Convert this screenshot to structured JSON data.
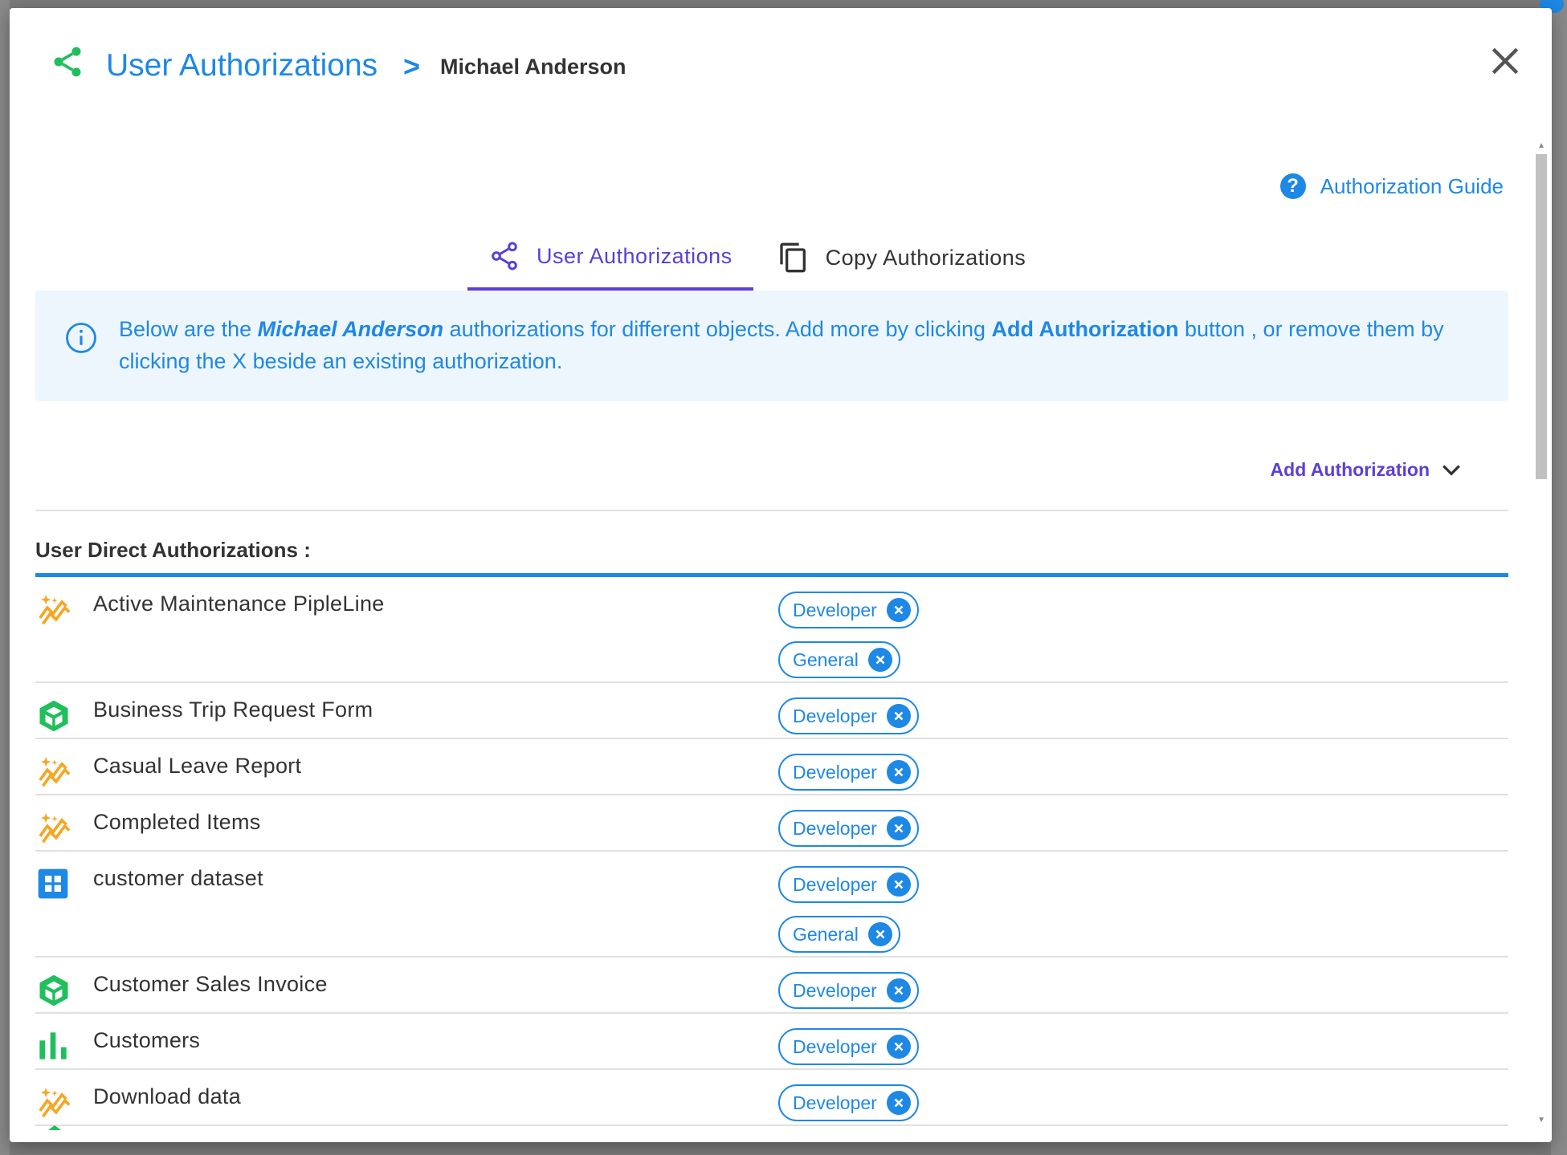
{
  "header": {
    "title": "User Authorizations",
    "separator": ">",
    "user_name": "Michael Anderson"
  },
  "guide": {
    "label": "Authorization Guide",
    "icon": "help-circle-icon"
  },
  "tabs": [
    {
      "label": "User Authorizations",
      "icon": "share-icon",
      "active": true
    },
    {
      "label": "Copy Authorizations",
      "icon": "copy-icon",
      "active": false
    }
  ],
  "info": {
    "part1": "Below are the ",
    "user_name": "Michael Anderson",
    "part2": " authorizations for different objects. Add more by clicking ",
    "button_ref": "Add Authorization",
    "part3": " button , or remove them by clicking the X beside an existing authorization."
  },
  "add_authorization": {
    "label": "Add Authorization"
  },
  "section": {
    "title": "User Direct Authorizations :"
  },
  "colors": {
    "primary": "#1e88e5",
    "accent": "#5c3fd6",
    "green": "#1fbf5b",
    "orange": "#f5a623"
  },
  "authorizations": [
    {
      "name": "Active Maintenance PipleLine",
      "icon": "pipeline-sparkle-icon",
      "roles": [
        "Developer",
        "General"
      ]
    },
    {
      "name": "Business Trip Request Form",
      "icon": "form-cube-icon",
      "roles": [
        "Developer"
      ]
    },
    {
      "name": "Casual Leave Report",
      "icon": "pipeline-sparkle-icon",
      "roles": [
        "Developer"
      ]
    },
    {
      "name": "Completed Items",
      "icon": "pipeline-sparkle-icon",
      "roles": [
        "Developer"
      ]
    },
    {
      "name": "customer dataset",
      "icon": "dataset-grid-icon",
      "roles": [
        "Developer",
        "General"
      ]
    },
    {
      "name": "Customer Sales Invoice",
      "icon": "form-cube-icon",
      "roles": [
        "Developer"
      ]
    },
    {
      "name": "Customers",
      "icon": "bar-chart-icon",
      "roles": [
        "Developer"
      ]
    },
    {
      "name": "Download data",
      "icon": "pipeline-sparkle-icon",
      "roles": [
        "Developer"
      ]
    }
  ]
}
